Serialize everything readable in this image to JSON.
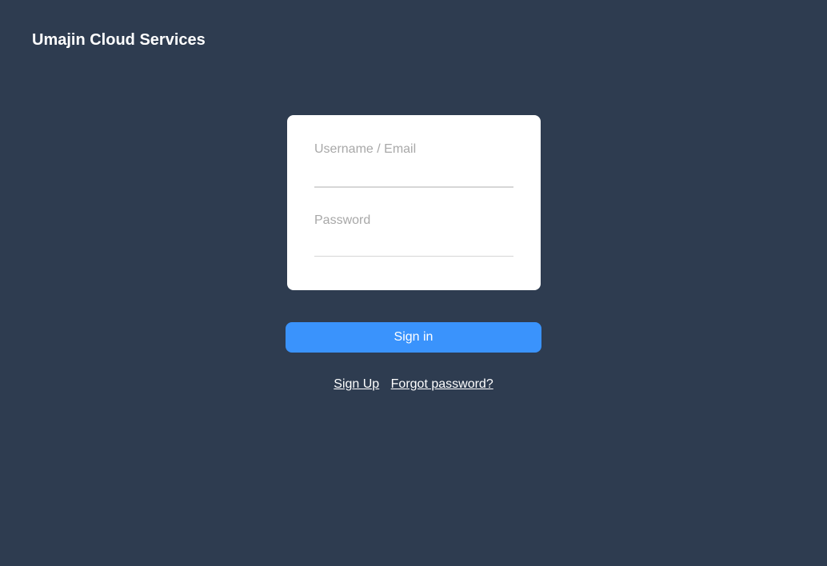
{
  "header": {
    "title": "Umajin Cloud Services"
  },
  "login": {
    "username_label": "Username / Email",
    "username_value": "",
    "password_label": "Password",
    "password_value": ""
  },
  "actions": {
    "signin_label": "Sign in",
    "signup_label": "Sign Up",
    "forgot_label": "Forgot password?"
  },
  "colors": {
    "background": "#2e3c50",
    "card": "#ffffff",
    "accent": "#3a93fc",
    "label": "#a8a8a8"
  }
}
